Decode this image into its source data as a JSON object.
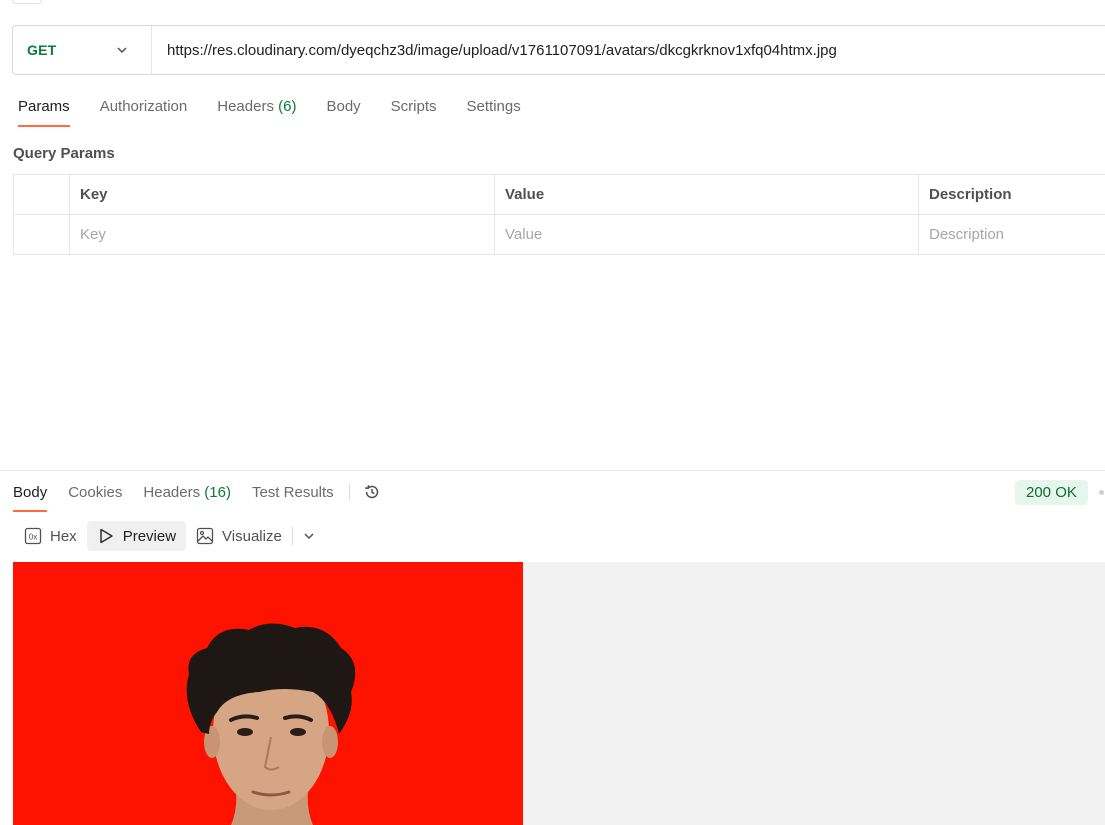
{
  "request": {
    "method": "GET",
    "url": "https://res.cloudinary.com/dyeqchz3d/image/upload/v1761107091/avatars/dkcgkrknov1xfq04htmx.jpg",
    "tabs": [
      {
        "label": "Params",
        "count": ""
      },
      {
        "label": "Authorization",
        "count": ""
      },
      {
        "label": "Headers",
        "count": "(6)"
      },
      {
        "label": "Body",
        "count": ""
      },
      {
        "label": "Scripts",
        "count": ""
      },
      {
        "label": "Settings",
        "count": ""
      }
    ]
  },
  "query_params": {
    "title": "Query Params",
    "headers": {
      "key": "Key",
      "value": "Value",
      "description": "Description"
    },
    "placeholders": {
      "key": "Key",
      "value": "Value",
      "description": "Description"
    }
  },
  "response": {
    "tabs": [
      {
        "label": "Body",
        "count": ""
      },
      {
        "label": "Cookies",
        "count": ""
      },
      {
        "label": "Headers",
        "count": "(16)"
      },
      {
        "label": "Test Results",
        "count": ""
      }
    ],
    "status": "200 OK",
    "view_modes": {
      "hex": "Hex",
      "preview": "Preview",
      "visualize": "Visualize"
    }
  },
  "colors": {
    "method": "#0b7a3b",
    "accent": "#ff6c37",
    "status_bg": "#e6f6ec",
    "image_bg": "#fd1300"
  },
  "icons": [
    "chevron-down-icon",
    "history-icon",
    "hex-icon",
    "play-icon",
    "image-icon"
  ]
}
